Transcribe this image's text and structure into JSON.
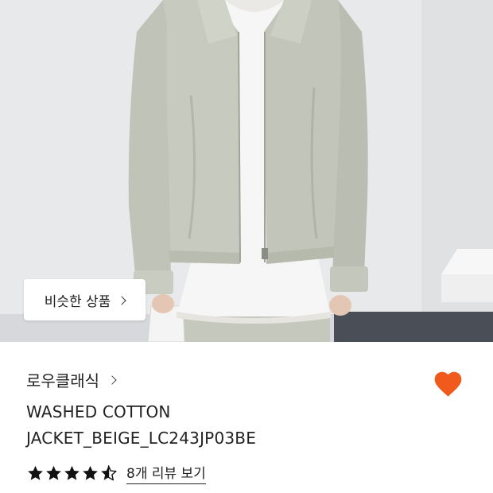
{
  "product": {
    "similar_button_label": "비슷한 상품",
    "brand_name": "로우클래식",
    "title_line1": "WASHED COTTON",
    "title_line2": "JACKET_BEIGE_LC243JP03BE",
    "rating": 4.5,
    "review_link_label": "8개 리뷰 보기",
    "liked": true
  },
  "icons": {
    "similar_chevron": "chevron-right-icon",
    "brand_chevron": "chevron-right-icon",
    "wishlist": "heart-icon",
    "star": "star-icon"
  },
  "colors": {
    "heart": "#f05a1c",
    "star": "#111111",
    "text": "#222222"
  }
}
